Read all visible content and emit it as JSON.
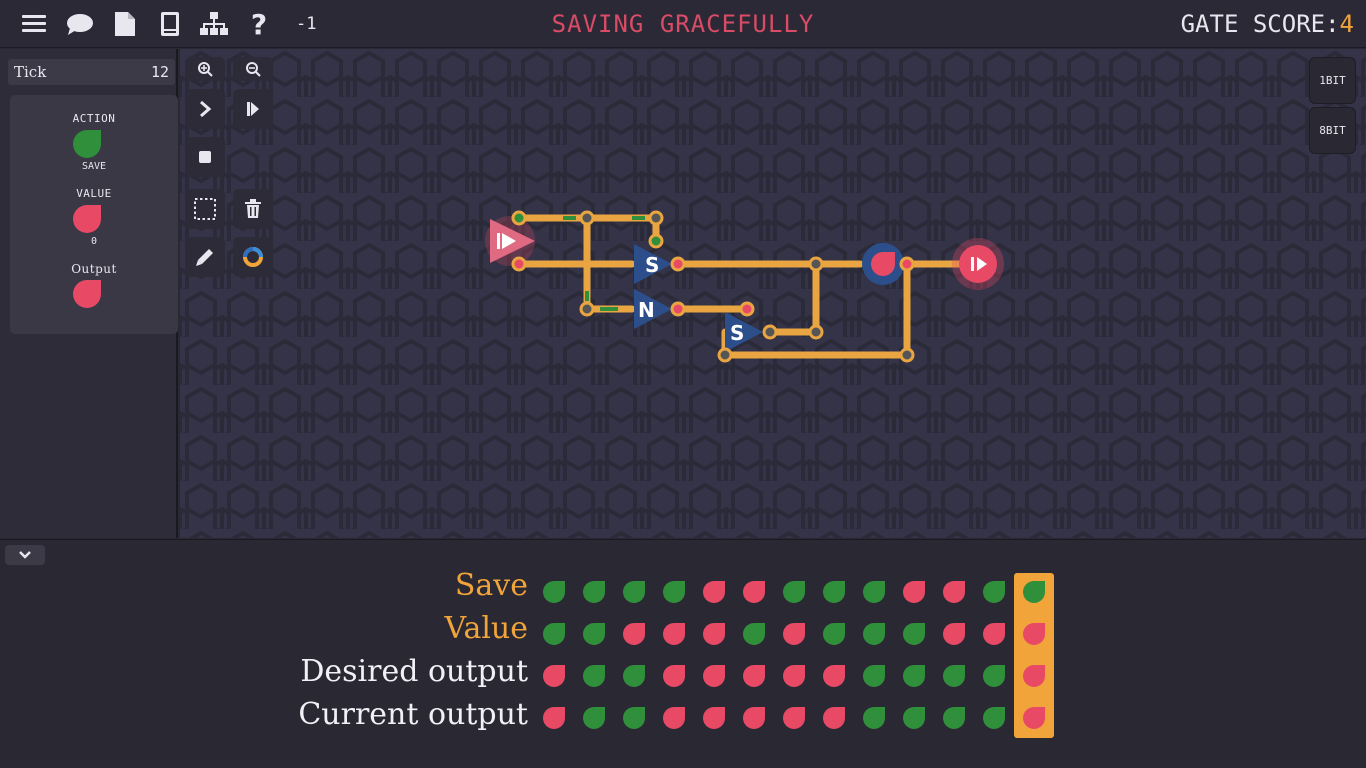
{
  "topbar": {
    "level_title": "SAVING GRACEFULLY",
    "undo_count": "-1",
    "gate_score_label": "GATE SCORE:",
    "gate_score_value": "4",
    "icons": [
      "menu-icon",
      "chat-icon",
      "document-icon",
      "book-icon",
      "hierarchy-icon",
      "help-icon"
    ]
  },
  "left_panel": {
    "tick_label": "Tick",
    "tick_value": "12",
    "action_label": "ACTION",
    "action_value": "SAVE",
    "action_color": "#2f8f3a",
    "value_label": "VALUE",
    "value_value": "0",
    "value_color": "#e84a66",
    "output_label": "Output",
    "output_color": "#e84a66"
  },
  "toolbar": {
    "buttons": [
      "zoom-in",
      "zoom-out",
      "step",
      "play",
      "stop",
      "select",
      "delete",
      "pencil",
      "color"
    ]
  },
  "side_buttons": {
    "one_bit": "1BIT",
    "eight_bit": "8BIT"
  },
  "circuit": {
    "gate_labels": [
      "S",
      "N",
      "S"
    ]
  },
  "truth_table": {
    "current_column": 13,
    "rows": [
      {
        "label": "Save",
        "kind": "input",
        "values": [
          1,
          1,
          1,
          1,
          0,
          0,
          1,
          1,
          1,
          0,
          0,
          1,
          1
        ]
      },
      {
        "label": "Value",
        "kind": "input",
        "values": [
          1,
          1,
          0,
          0,
          0,
          1,
          0,
          1,
          1,
          1,
          0,
          0,
          0
        ]
      },
      {
        "label": "Desired output",
        "kind": "output",
        "values": [
          0,
          1,
          1,
          0,
          0,
          0,
          0,
          0,
          1,
          1,
          1,
          1,
          0
        ]
      },
      {
        "label": "Current output",
        "kind": "output",
        "values": [
          0,
          1,
          1,
          0,
          0,
          0,
          0,
          0,
          1,
          1,
          1,
          1,
          0
        ]
      }
    ]
  },
  "colors": {
    "on": "#2f8f3a",
    "off": "#e84a66",
    "wire": "#e9a542",
    "accent": "#f0a43a",
    "title": "#d94b66"
  }
}
